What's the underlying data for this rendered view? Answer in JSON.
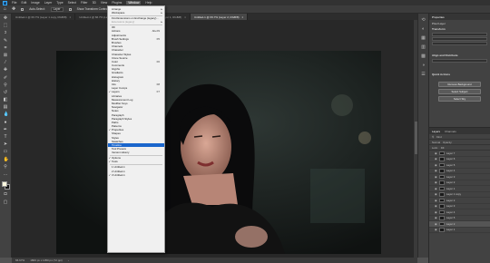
{
  "menubar": {
    "logo": "Ps",
    "items": [
      "File",
      "Edit",
      "Image",
      "Layer",
      "Type",
      "Select",
      "Filter",
      "3D",
      "View",
      "Plugins",
      "Window",
      "Help"
    ],
    "active_index": 10
  },
  "options_bar": {
    "auto_select_label": "Auto-Select:",
    "auto_select_value": "Layer",
    "show_transform_label": "Show Transform Controls"
  },
  "doc_tabs": [
    {
      "label": "Untitled-1 @ 66.7% (Layer 1 copy, RGB/8)",
      "active": false
    },
    {
      "label": "Untitled-1 @ 66.7% (Layer 2, RGB/8)",
      "active": false
    },
    {
      "label": "Untitled-1 @ 66.7% (Layer 1, RGB/8)",
      "active": false
    },
    {
      "label": "Untitled-1 @ 66.7% (Layer 2, RGB/8)",
      "active": true
    }
  ],
  "status": {
    "zoom": "66.67%",
    "doc_size": "1800 px x 1050 px (72 ppi)"
  },
  "window_menu": {
    "items": [
      {
        "label": "Arrange",
        "arrow": true
      },
      {
        "label": "Workspace",
        "arrow": true
      },
      {
        "sep": true
      },
      {
        "label": "Find Extensions on Exchange (legacy)..."
      },
      {
        "label": "Extensions (legacy)",
        "arrow": true,
        "dim": true
      },
      {
        "sep": true
      },
      {
        "label": "3D"
      },
      {
        "label": "Actions",
        "shortcut": "Alt+F9"
      },
      {
        "label": "Adjustments"
      },
      {
        "label": "Brush Settings",
        "shortcut": "F5"
      },
      {
        "label": "Brushes"
      },
      {
        "label": "Channels"
      },
      {
        "label": "Character"
      },
      {
        "label": "Character Styles"
      },
      {
        "label": "Clone Source"
      },
      {
        "label": "Color",
        "shortcut": "F6"
      },
      {
        "label": "Comments"
      },
      {
        "label": "Glyphs"
      },
      {
        "label": "Gradients"
      },
      {
        "label": "Histogram"
      },
      {
        "label": "History"
      },
      {
        "label": "Info",
        "shortcut": "F8"
      },
      {
        "label": "Layer Comps"
      },
      {
        "label": "Layers",
        "shortcut": "F7",
        "checked": true
      },
      {
        "label": "Libraries"
      },
      {
        "label": "Measurement Log"
      },
      {
        "label": "Modifier Keys"
      },
      {
        "label": "Navigator"
      },
      {
        "label": "Notes"
      },
      {
        "label": "Paragraph"
      },
      {
        "label": "Paragraph Styles"
      },
      {
        "label": "Paths"
      },
      {
        "label": "Patterns"
      },
      {
        "label": "Properties",
        "checked": true
      },
      {
        "label": "Shapes"
      },
      {
        "label": "Styles"
      },
      {
        "label": "Swatches"
      },
      {
        "label": "Timeline",
        "highlight": true
      },
      {
        "label": "Tool Presets"
      },
      {
        "label": "Version History"
      },
      {
        "sep": true
      },
      {
        "label": "Options",
        "checked": true
      },
      {
        "label": "Tools",
        "checked": true
      },
      {
        "sep": true
      },
      {
        "label": "1 Untitled-1"
      },
      {
        "label": "2 Untitled-1"
      },
      {
        "label": "3 Untitled-1",
        "checked": true
      }
    ]
  },
  "right_panel": {
    "tabs": [
      "Properties"
    ],
    "doc_label": "Pixel Layer",
    "transform_label": "Transform",
    "align_label": "Align and Distribute",
    "quick_actions_label": "Quick Actions",
    "buttons": [
      "Remove Background",
      "Select Subject",
      "Select Sky"
    ]
  },
  "layers_panel": {
    "tabs": [
      "Layers",
      "Channels"
    ],
    "kind_label": "Kind",
    "blend_mode": "Normal",
    "opacity_label": "Opacity:",
    "lock_label": "Lock:",
    "fill_label": "Fill:",
    "layers": [
      "Layer 7",
      "Layer 6",
      "Layer 5",
      "Layer 4",
      "Layer 3",
      "Layer 2",
      "Layer 1",
      "Layer 1 copy",
      "Layer 2",
      "Layer 3",
      "Layer 4",
      "Layer 5",
      "Layer 2",
      "Layer 1"
    ],
    "selected_index": 12
  },
  "colors": {
    "accent": "#1a66cc",
    "menu_bg": "#f0f0f0",
    "app_bg": "#535353"
  }
}
